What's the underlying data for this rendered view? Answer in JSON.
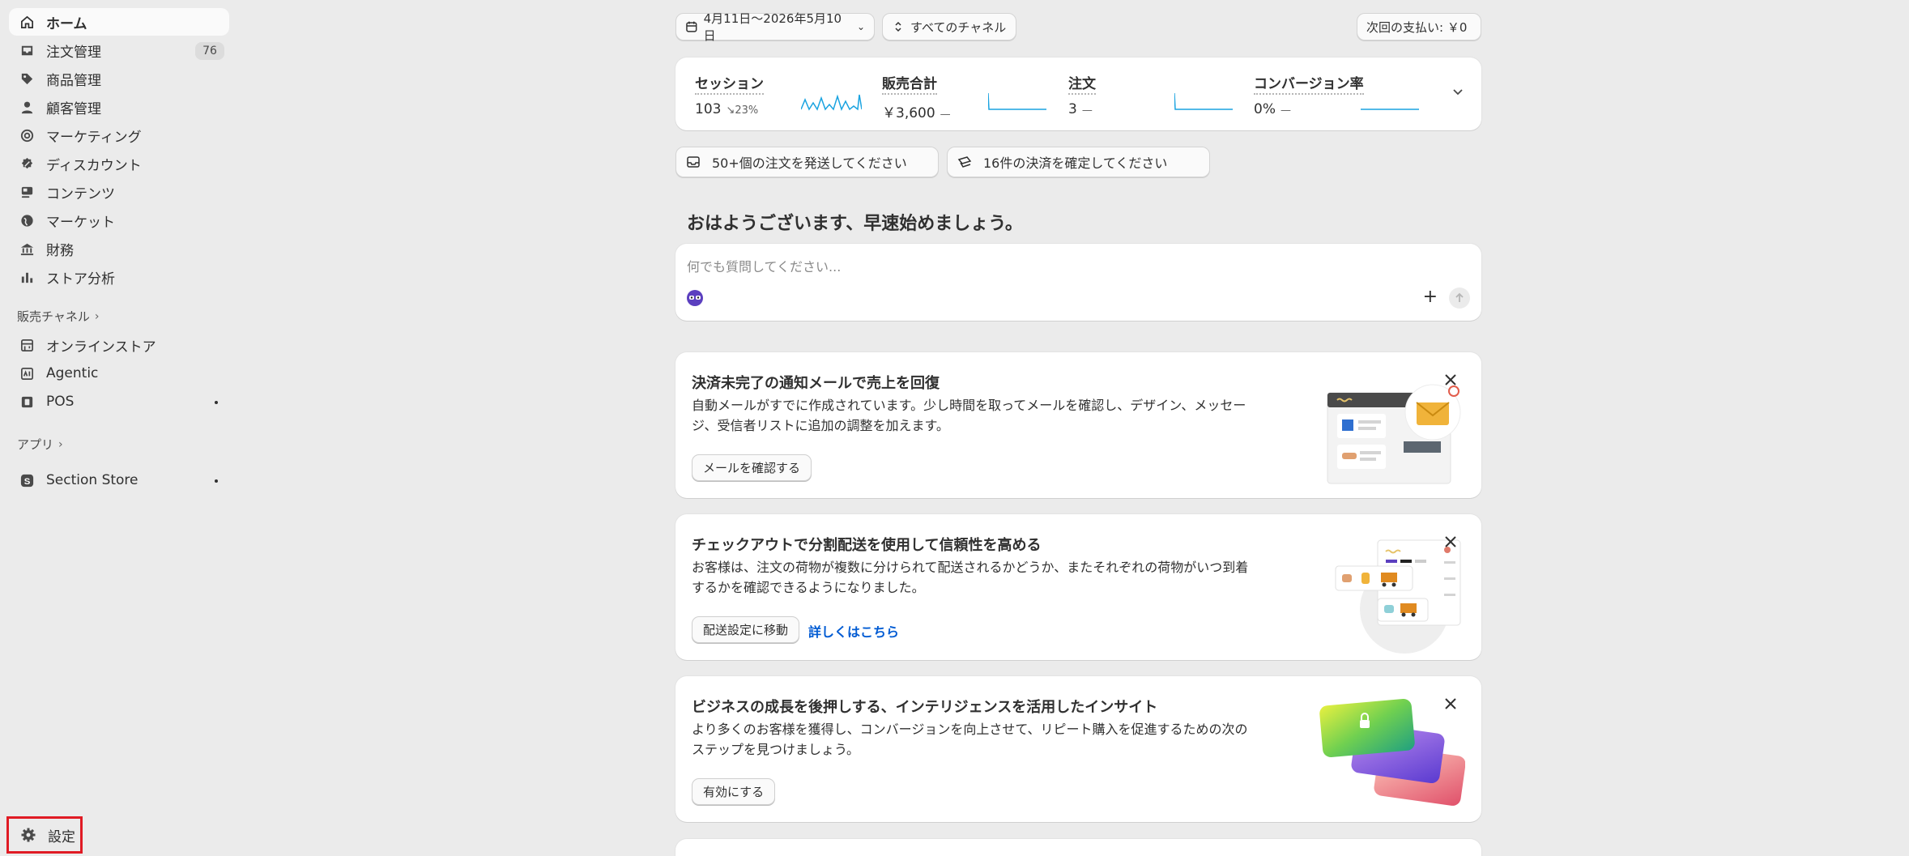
{
  "sidebar": {
    "items": [
      {
        "label": "ホーム",
        "icon": "home-icon",
        "active": true
      },
      {
        "label": "注文管理",
        "icon": "inbox-icon",
        "badge": "76"
      },
      {
        "label": "商品管理",
        "icon": "tag-icon"
      },
      {
        "label": "顧客管理",
        "icon": "person-icon"
      },
      {
        "label": "マーケティング",
        "icon": "target-icon"
      },
      {
        "label": "ディスカウント",
        "icon": "discount-icon"
      },
      {
        "label": "コンテンツ",
        "icon": "content-icon"
      },
      {
        "label": "マーケット",
        "icon": "globe-icon"
      },
      {
        "label": "財務",
        "icon": "bank-icon"
      },
      {
        "label": "ストア分析",
        "icon": "bar-chart-icon"
      }
    ],
    "sales_channels_label": "販売チャネル",
    "channels": [
      {
        "label": "オンラインストア",
        "icon": "store-icon"
      },
      {
        "label": "Agentic",
        "icon": "agentic-icon"
      },
      {
        "label": "POS",
        "icon": "pos-icon"
      }
    ],
    "apps_label": "アプリ",
    "apps": [
      {
        "label": "Section Store",
        "icon": "section-store-icon"
      }
    ],
    "settings_label": "設定"
  },
  "topbar": {
    "date_range": "4月11日〜2026年5月10日",
    "channel_filter": "すべてのチャネル",
    "next_payment": "次回の支払い: ￥0"
  },
  "metrics": [
    {
      "label": "セッション",
      "value": "103",
      "delta": "↘23%"
    },
    {
      "label": "販売合計",
      "value": "￥3,600",
      "delta": "—"
    },
    {
      "label": "注文",
      "value": "3",
      "delta": "—"
    },
    {
      "label": "コンバージョン率",
      "value": "0%",
      "delta": "—"
    }
  ],
  "tasks": [
    {
      "label": "50+個の注文を発送してください"
    },
    {
      "label": "16件の決済を確定してください"
    }
  ],
  "greeting": "おはようございます、早速始めましょう。",
  "ask": {
    "placeholder": "何でも質問してください..."
  },
  "promos": [
    {
      "title": "決済未完了の通知メールで売上を回復",
      "body": "自動メールがすでに作成されています。少し時間を取ってメールを確認し、デザイン、メッセージ、受信者リストに追加の調整を加えます。",
      "button": "メールを確認する"
    },
    {
      "title": "チェックアウトで分割配送を使用して信頼性を高める",
      "body": "お客様は、注文の荷物が複数に分けられて配送されるかどうか、またそれぞれの荷物がいつ到着するかを確認できるようになりました。",
      "button": "配送設定に移動",
      "link": "詳しくはこちら"
    },
    {
      "title": "ビジネスの成長を後押しする、インテリジェンスを活用したインサイト",
      "body": "より多くのお客様を獲得し、コンバージョンを向上させて、リピート購入を促進するための次のステップを見つけましょう。",
      "button": "有効にする"
    }
  ],
  "colors": {
    "accent_link": "#005bd3",
    "highlight": "#e01b24",
    "sparkline": "#1aa3e0"
  }
}
